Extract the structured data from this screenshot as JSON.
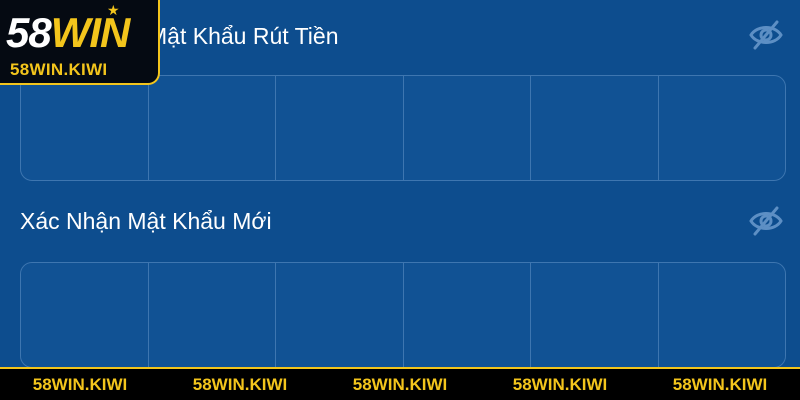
{
  "brand": {
    "logo_number": "58",
    "logo_word": "WIN",
    "logo_domain": "58WIN.KIWI"
  },
  "form": {
    "withdraw_password_label": "Mật Khẩu Rút Tiền",
    "confirm_password_label": "Xác Nhận Mật Khẩu Mới",
    "pin_length": 6
  },
  "banner": {
    "items": [
      "58WIN.KIWI",
      "58WIN.KIWI",
      "58WIN.KIWI",
      "58WIN.KIWI",
      "58WIN.KIWI"
    ]
  },
  "icons": {
    "toggle_visibility": "eye-off-icon"
  },
  "colors": {
    "background": "#0d4d8e",
    "cell_border": "#3e76b0",
    "brand_gold": "#f3c51c",
    "icon": "#5d8fc4"
  }
}
